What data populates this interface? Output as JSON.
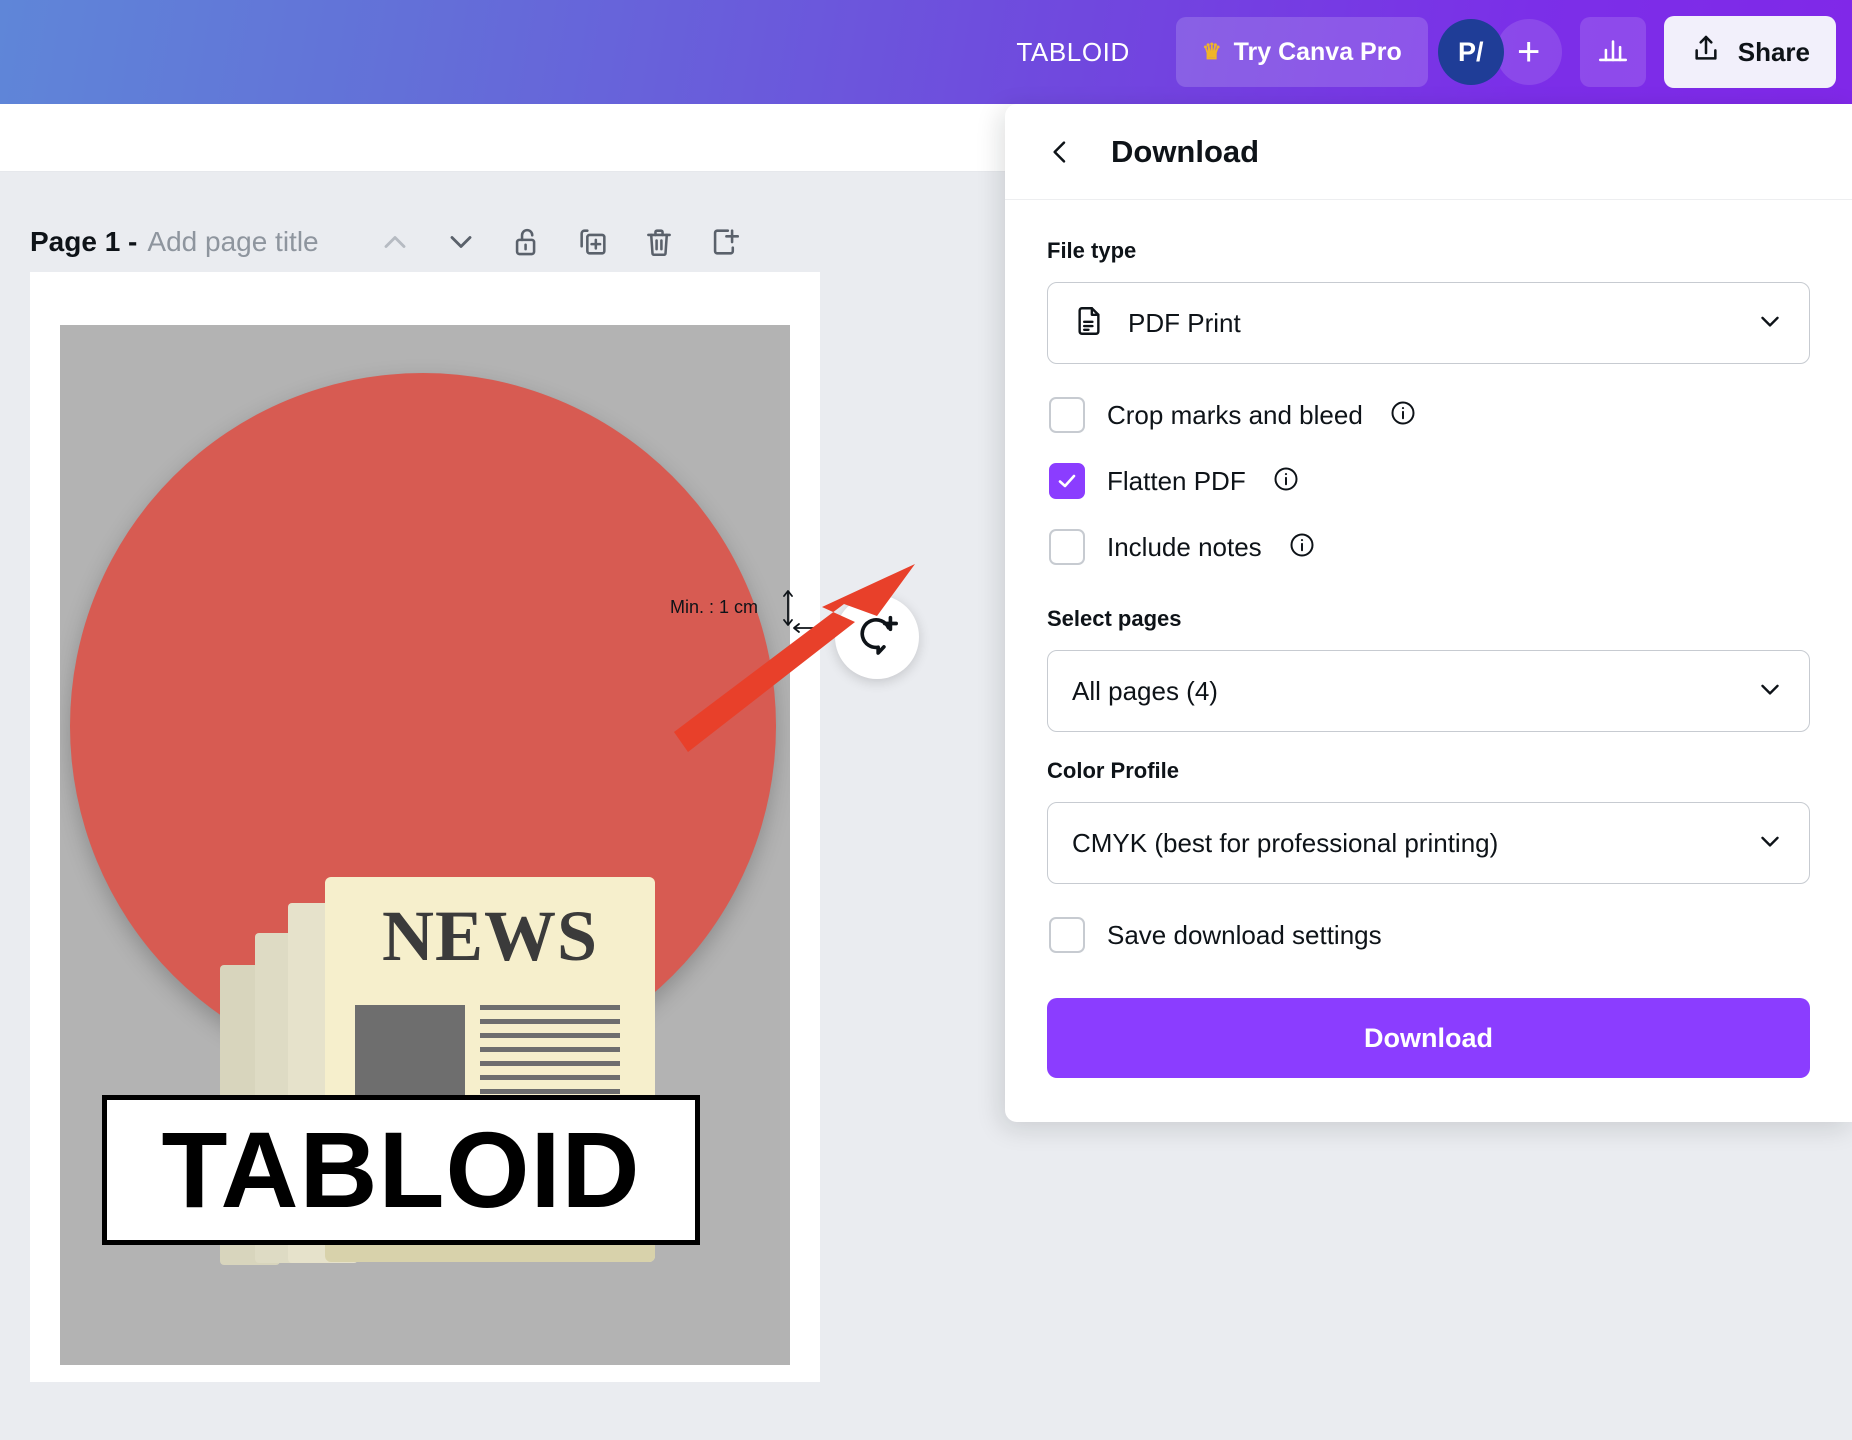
{
  "topbar": {
    "document_size": "TABLOID",
    "pro_button": "Try Canva Pro",
    "crown_icon": "crown-icon",
    "avatar_initials": "P/",
    "plus_label": "+",
    "chart_icon": "bar-chart-icon",
    "share_label": "Share",
    "share_icon": "upload-share-icon",
    "gradient_start": "#5f86d8",
    "gradient_end": "#8028e8"
  },
  "page_toolbar": {
    "page_label": "Page 1 -",
    "page_title_placeholder": "Add page title",
    "icons": [
      {
        "name": "move-page-up-icon",
        "glyph": "chevron-up"
      },
      {
        "name": "move-page-down-icon",
        "glyph": "chevron-down"
      },
      {
        "name": "unlock-icon",
        "glyph": "unlock"
      },
      {
        "name": "duplicate-page-icon",
        "glyph": "duplicate"
      },
      {
        "name": "delete-page-icon",
        "glyph": "trash"
      },
      {
        "name": "add-page-icon",
        "glyph": "add-page"
      }
    ]
  },
  "canvas": {
    "min_margin_label": "Min. : 1 cm",
    "newspaper_headline": "NEWS",
    "tabloid_text": "TABLOID",
    "circle_color": "#d75b52",
    "page_background": "#b3b3b3",
    "newspaper_paper_color": "#f6efcc",
    "comment_icon": "add-comment-icon"
  },
  "download_panel": {
    "back_icon": "back-chevron-icon",
    "title": "Download",
    "file_type": {
      "label": "File type",
      "selected": "PDF Print",
      "icon": "pdf-file-icon",
      "chevron": "chevron-down-icon"
    },
    "options": [
      {
        "label": "Crop marks and bleed",
        "checked": false,
        "info_icon": "info-icon",
        "name": "crop-marks-and-bleed"
      },
      {
        "label": "Flatten PDF",
        "checked": true,
        "info_icon": "info-icon",
        "name": "flatten-pdf"
      },
      {
        "label": "Include notes",
        "checked": false,
        "info_icon": "info-icon",
        "name": "include-notes"
      }
    ],
    "select_pages": {
      "label": "Select pages",
      "selected": "All pages (4)",
      "chevron": "chevron-down-icon"
    },
    "color_profile": {
      "label": "Color Profile",
      "selected": "CMYK (best for professional printing)",
      "chevron": "chevron-down-icon"
    },
    "save_settings": {
      "label": "Save download settings",
      "checked": false,
      "name": "save-download-settings"
    },
    "download_button": "Download",
    "accent_color": "#8b3dff"
  },
  "annotation": {
    "arrow_color": "#e8402a",
    "name": "red-pointer-arrow"
  }
}
